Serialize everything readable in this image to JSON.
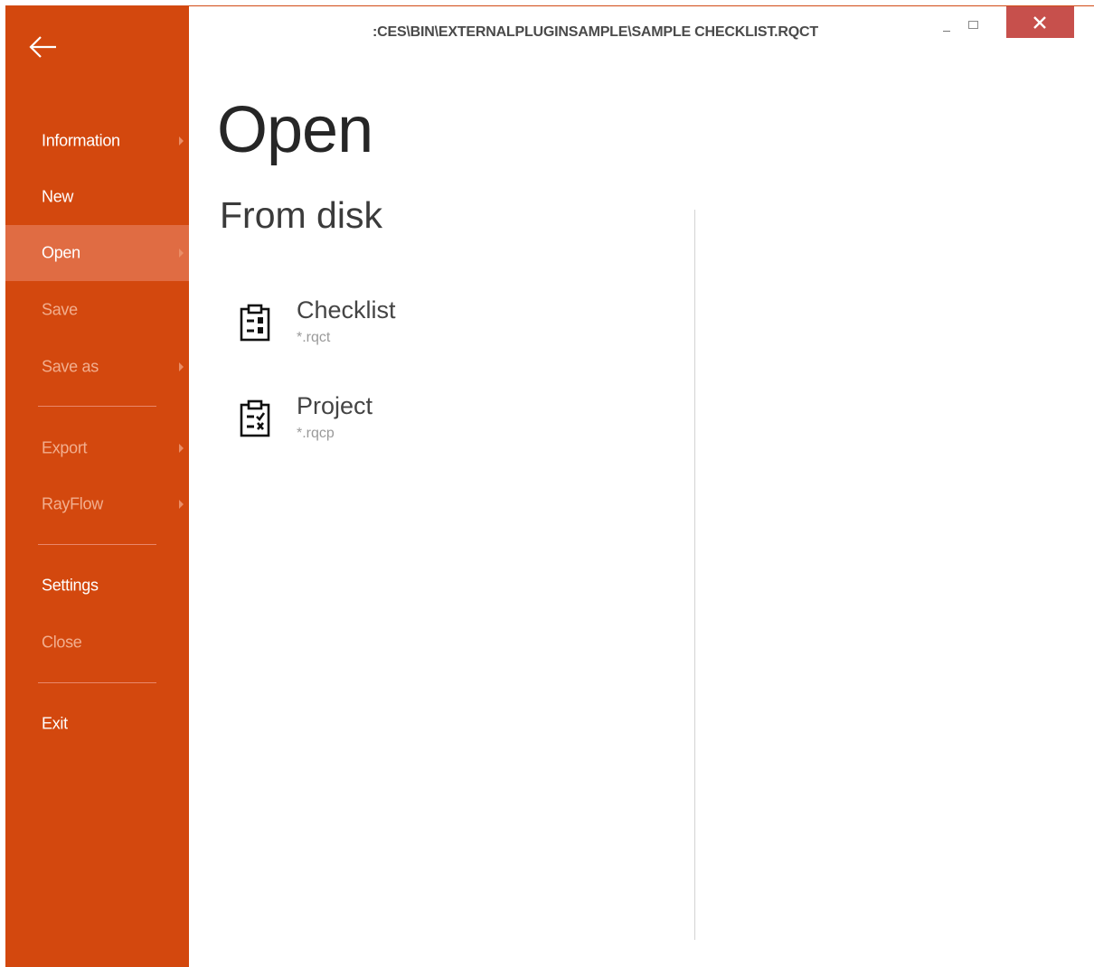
{
  "window": {
    "title": ":CES\\BIN\\EXTERNALPLUGINSAMPLE\\SAMPLE CHECKLIST.RQCT",
    "controls": [
      "minimize-icon",
      "maximize-icon",
      "close-icon"
    ],
    "accent_color": "#d3480e",
    "close_color": "#c7504c"
  },
  "sidebar": {
    "back_icon": "arrow-left-icon",
    "items": [
      {
        "label": "Information",
        "submenu": true,
        "enabled": true,
        "selected": false
      },
      {
        "label": "New",
        "submenu": false,
        "enabled": true,
        "selected": false
      },
      {
        "label": "Open",
        "submenu": true,
        "enabled": true,
        "selected": true
      },
      {
        "label": "Save",
        "submenu": false,
        "enabled": false,
        "selected": false
      },
      {
        "label": "Save as",
        "submenu": true,
        "enabled": false,
        "selected": false
      },
      {
        "label": "Export",
        "submenu": true,
        "enabled": false,
        "selected": false
      },
      {
        "label": "RayFlow",
        "submenu": true,
        "enabled": false,
        "selected": false
      },
      {
        "label": "Settings",
        "submenu": false,
        "enabled": true,
        "selected": false
      },
      {
        "label": "Close",
        "submenu": false,
        "enabled": false,
        "selected": false
      },
      {
        "label": "Exit",
        "submenu": false,
        "enabled": true,
        "selected": false
      }
    ]
  },
  "main": {
    "title": "Open",
    "section_title": "From disk",
    "options": [
      {
        "name": "Checklist",
        "extension": "*.rqct",
        "icon": "checklist-file-icon"
      },
      {
        "name": "Project",
        "extension": "*.rqcp",
        "icon": "project-file-icon"
      }
    ]
  }
}
